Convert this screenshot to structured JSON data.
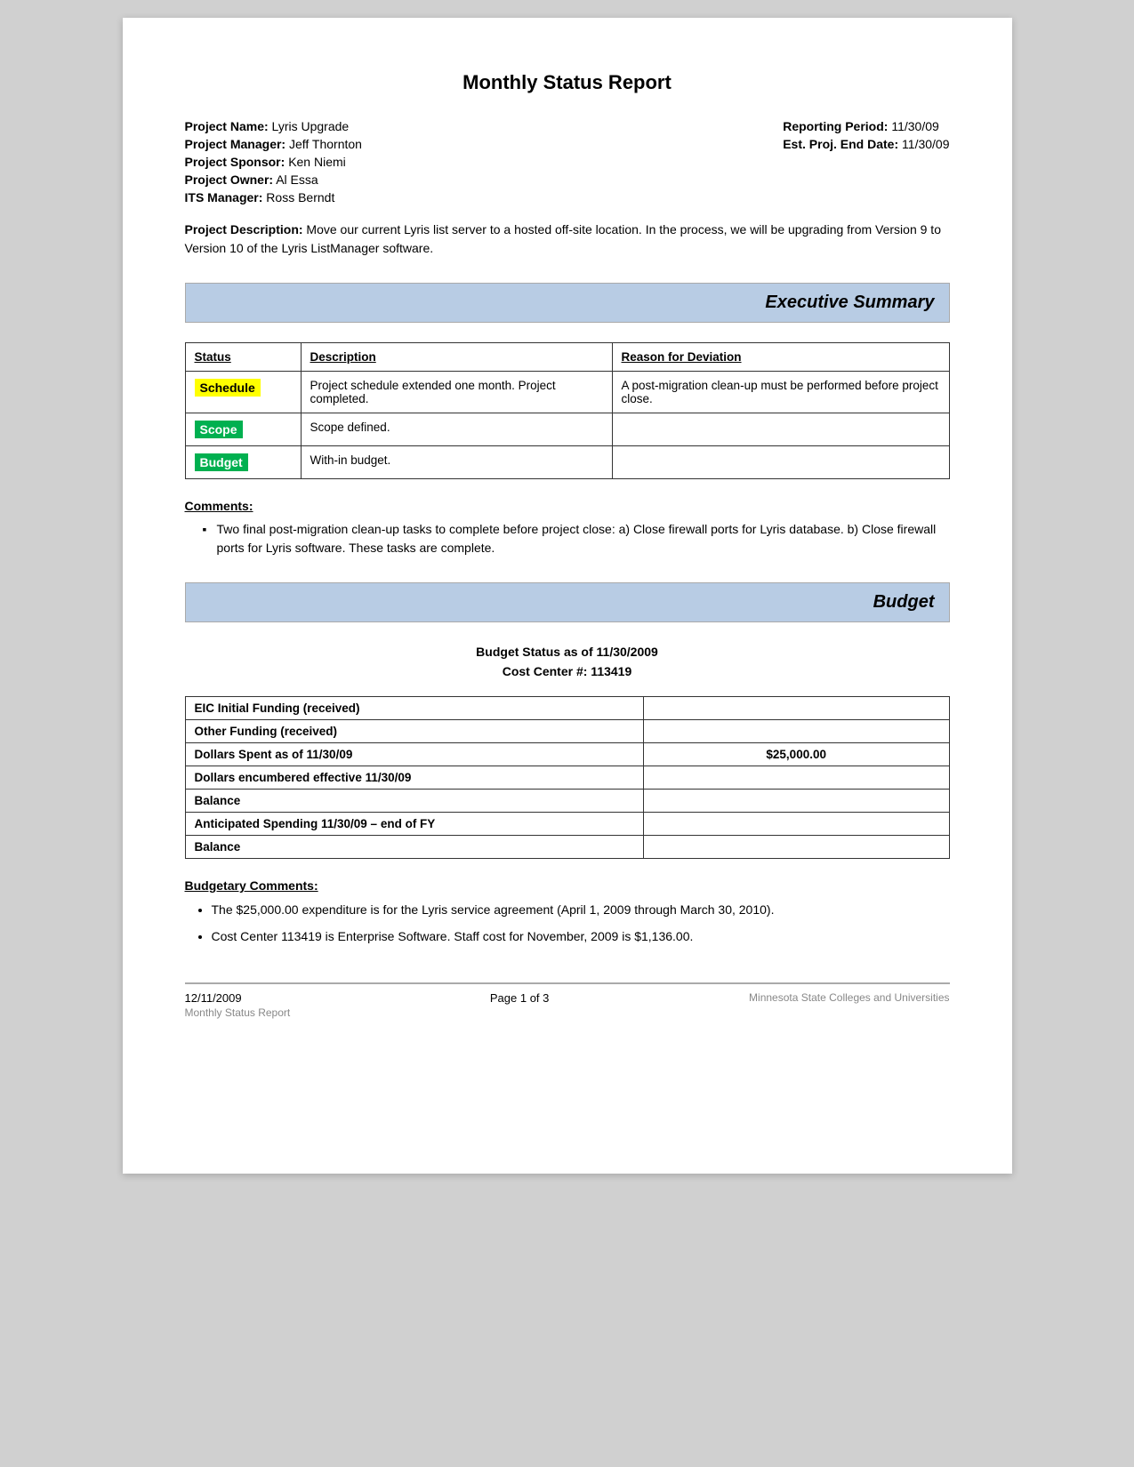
{
  "page": {
    "title": "Monthly Status Report"
  },
  "meta": {
    "left": [
      {
        "label": "Project Name:",
        "value": "Lyris Upgrade"
      },
      {
        "label": "Project Manager:",
        "value": "Jeff Thornton"
      },
      {
        "label": "Project Sponsor:",
        "value": "Ken Niemi"
      },
      {
        "label": "Project Owner:",
        "value": "Al Essa"
      },
      {
        "label": "ITS Manager:",
        "value": "Ross Berndt"
      }
    ],
    "right": [
      {
        "label": "Reporting Period:",
        "value": "11/30/09"
      },
      {
        "label": "Est. Proj. End Date:",
        "value": "11/30/09"
      }
    ]
  },
  "project_description": {
    "label": "Project Description:",
    "text": "Move our current Lyris list server to a hosted off-site location.  In the process, we will be upgrading from Version 9 to Version 10 of the Lyris ListManager software."
  },
  "executive_summary": {
    "header": "Executive Summary",
    "table": {
      "columns": [
        "Status",
        "Description",
        "Reason for Deviation"
      ],
      "rows": [
        {
          "status": "Schedule",
          "status_type": "yellow",
          "description": "Project schedule extended one month.  Project completed.",
          "reason": "A post-migration clean-up must be performed before project close."
        },
        {
          "status": "Scope",
          "status_type": "green",
          "description": "Scope defined.",
          "reason": ""
        },
        {
          "status": "Budget",
          "status_type": "green",
          "description": "With-in budget.",
          "reason": ""
        }
      ]
    },
    "comments_label": "Comments:",
    "comments": [
      "Two final post-migration clean-up tasks to complete before project close:  a) Close firewall ports for Lyris database.  b) Close firewall ports for Lyris software.  These tasks are complete."
    ]
  },
  "budget": {
    "header": "Budget",
    "status_title_line1": "Budget Status as of 11/30/2009",
    "status_title_line2": "Cost Center #: 113419",
    "table_rows": [
      {
        "label": "EIC Initial Funding (received)",
        "value": ""
      },
      {
        "label": "Other Funding (received)",
        "value": ""
      },
      {
        "label": "Dollars Spent as of 11/30/09",
        "value": "$25,000.00"
      },
      {
        "label": "Dollars encumbered effective 11/30/09",
        "value": ""
      },
      {
        "label": "Balance",
        "value": ""
      },
      {
        "label": "Anticipated Spending 11/30/09 – end of FY",
        "value": ""
      },
      {
        "label": "Balance",
        "value": ""
      }
    ],
    "budgetary_comments_label": "Budgetary Comments:",
    "budgetary_comments": [
      "The $25,000.00 expenditure is for the Lyris service agreement (April 1, 2009 through March 30, 2010).",
      "Cost Center 113419 is Enterprise Software.  Staff cost for November, 2009 is $1,136.00."
    ]
  },
  "footer": {
    "date": "12/11/2009",
    "subtitle": "Monthly Status Report",
    "page": "Page 1 of 3",
    "organization": "Minnesota State Colleges and Universities"
  }
}
